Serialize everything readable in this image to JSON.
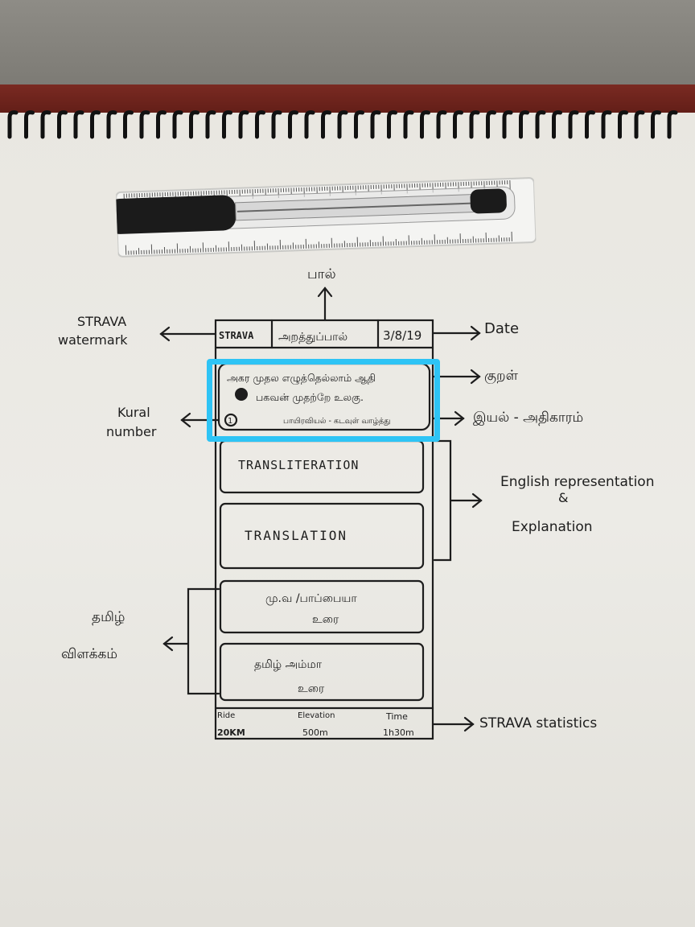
{
  "annotations": {
    "paal": "பால்",
    "strava_watermark": "STRAVA\nwatermark",
    "date_note": "Date",
    "kural_note": "குறள்",
    "iyal_note": "இயல் - அதிகாரம்",
    "kural_number_note": "Kural\nnumber",
    "english_rep": "English representation",
    "ampersand": "&",
    "explanation": "Explanation",
    "tamil_vilakkam": "தமிழ்\nவிளக்கம்",
    "strava_stats_note": "STRAVA statistics"
  },
  "mockup": {
    "header": {
      "brand": "STRAVA",
      "section": "அறத்துப்பால்",
      "date": "3/8/19"
    },
    "kural_card": {
      "line1": "அகர முதல எழுத்தெல்லாம் ஆதி",
      "line2": "பகவன் முதற்றே உலகு.",
      "number": "1",
      "chapter": "பாயிரவியல் - கடவுள் வாழ்த்து"
    },
    "transliteration": "TRANSLITERATION",
    "translation": "TRANSLATION",
    "urai1": {
      "line1": "மு.வ /பாப்பையா",
      "line2": "உரை"
    },
    "urai2": {
      "line1": "தமிழ் அம்மா",
      "line2": "உரை"
    },
    "stats": {
      "ride_label": "Ride",
      "ride_value": "20KM",
      "elev_label": "Elevation",
      "elev_value": "500m",
      "time_label": "Time",
      "time_value": "1h30m"
    }
  },
  "colors": {
    "highlight": "#2ec4f5",
    "ink": "#1d1d1d",
    "paper": "#e9e7e1"
  }
}
